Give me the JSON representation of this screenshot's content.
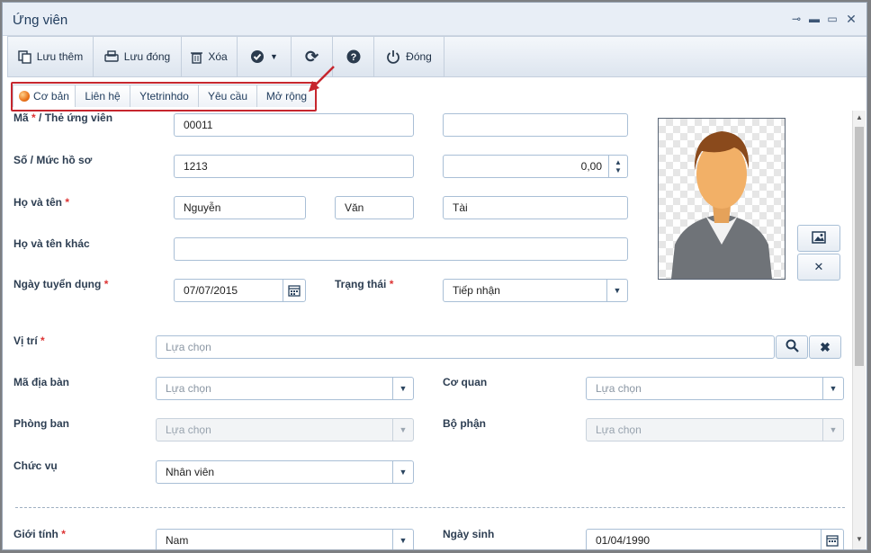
{
  "window": {
    "title": "Ứng viên"
  },
  "toolbar": {
    "save_add": "Lưu thêm",
    "save_close": "Lưu đóng",
    "delete": "Xóa",
    "close": "Đóng"
  },
  "tabs": [
    {
      "label": "Cơ bản",
      "active": true
    },
    {
      "label": "Liên hệ"
    },
    {
      "label": "Ytetrinhdo"
    },
    {
      "label": "Yêu cầu"
    },
    {
      "label": "Mở rộng"
    }
  ],
  "form": {
    "code_label": "Mã * / Thẻ ứng viên",
    "code_label_main": "Mã",
    "code_label_rest": " / Thẻ ứng viên",
    "code_value": "00011",
    "card_value": "",
    "file_label": "Số / Mức hồ sơ",
    "file_value": "1213",
    "level_value": "0,00",
    "name_label": "Họ và tên",
    "last_name": "Nguyễn",
    "middle_name": "Văn",
    "first_name": "Tài",
    "other_name_label": "Họ và tên khác",
    "other_name_value": "",
    "hire_date_label": "Ngày tuyển dụng",
    "hire_date_value": "07/07/2015",
    "status_label": "Trạng thái",
    "status_value": "Tiếp nhận",
    "position_label": "Vị trí",
    "position_placeholder": "Lựa chọn",
    "area_label": "Mã địa bàn",
    "area_placeholder": "Lựa chọn",
    "agency_label": "Cơ quan",
    "agency_placeholder": "Lựa chọn",
    "department_label": "Phòng ban",
    "department_placeholder": "Lựa chọn",
    "section_label": "Bộ phận",
    "section_placeholder": "Lựa chọn",
    "title_label": "Chức vụ",
    "title_value": "Nhân viên",
    "gender_label": "Giới tính",
    "gender_value": "Nam",
    "birth_label": "Ngày sinh",
    "birth_value": "01/04/1990",
    "required_mark": "*"
  },
  "colors": {
    "accent_red": "#c6262e",
    "border": "#a9bfd6",
    "title_text": "#1f3b5c"
  },
  "icons": [
    "pin-icon",
    "minimize-icon",
    "maximize-icon",
    "close-icon",
    "copy-icon",
    "save-icon",
    "trash-icon",
    "check-circle-icon",
    "refresh-icon",
    "help-icon",
    "power-icon",
    "calendar-icon",
    "search-icon",
    "clear-icon",
    "image-icon",
    "avatar-image"
  ]
}
